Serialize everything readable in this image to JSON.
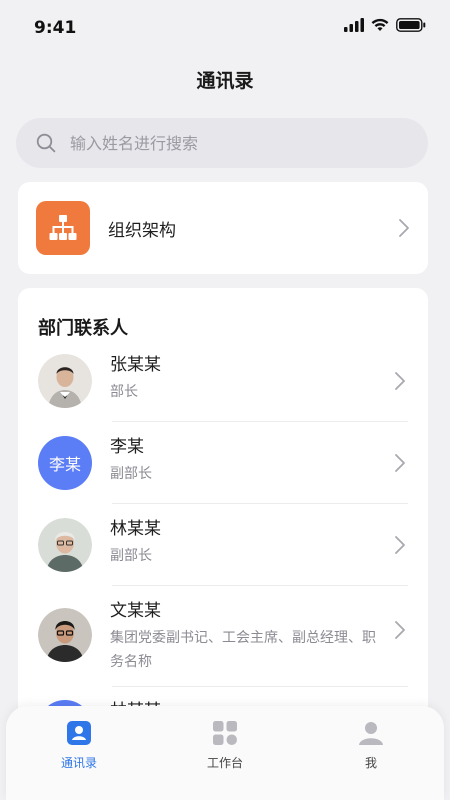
{
  "status_bar": {
    "time": "9:41"
  },
  "nav": {
    "title": "通讯录"
  },
  "search": {
    "placeholder": "输入姓名进行搜索"
  },
  "org": {
    "label": "组织架构",
    "icon": "org-chart-icon",
    "color": "#f07a3d"
  },
  "department": {
    "title": "部门联系人",
    "contacts": [
      {
        "name": "张某某",
        "role": "部长",
        "avatar": "photo"
      },
      {
        "name": "李某",
        "role": "副部长",
        "avatar": "李某",
        "color": "#5b7df5"
      },
      {
        "name": "林某某",
        "role": "副部长",
        "avatar": "photo"
      },
      {
        "name": "文某某",
        "role": "集团党委副书记、工会主席、副总经理、职务名称",
        "avatar": "photo"
      },
      {
        "name": "林某某",
        "role": "",
        "avatar": "photo"
      }
    ]
  },
  "tabbar": {
    "tabs": [
      {
        "label": "通讯录",
        "icon": "contacts-icon",
        "active": true
      },
      {
        "label": "工作台",
        "icon": "grid-icon",
        "active": false
      },
      {
        "label": "我",
        "icon": "person-icon",
        "active": false
      }
    ],
    "active_color": "#2f76e8"
  }
}
